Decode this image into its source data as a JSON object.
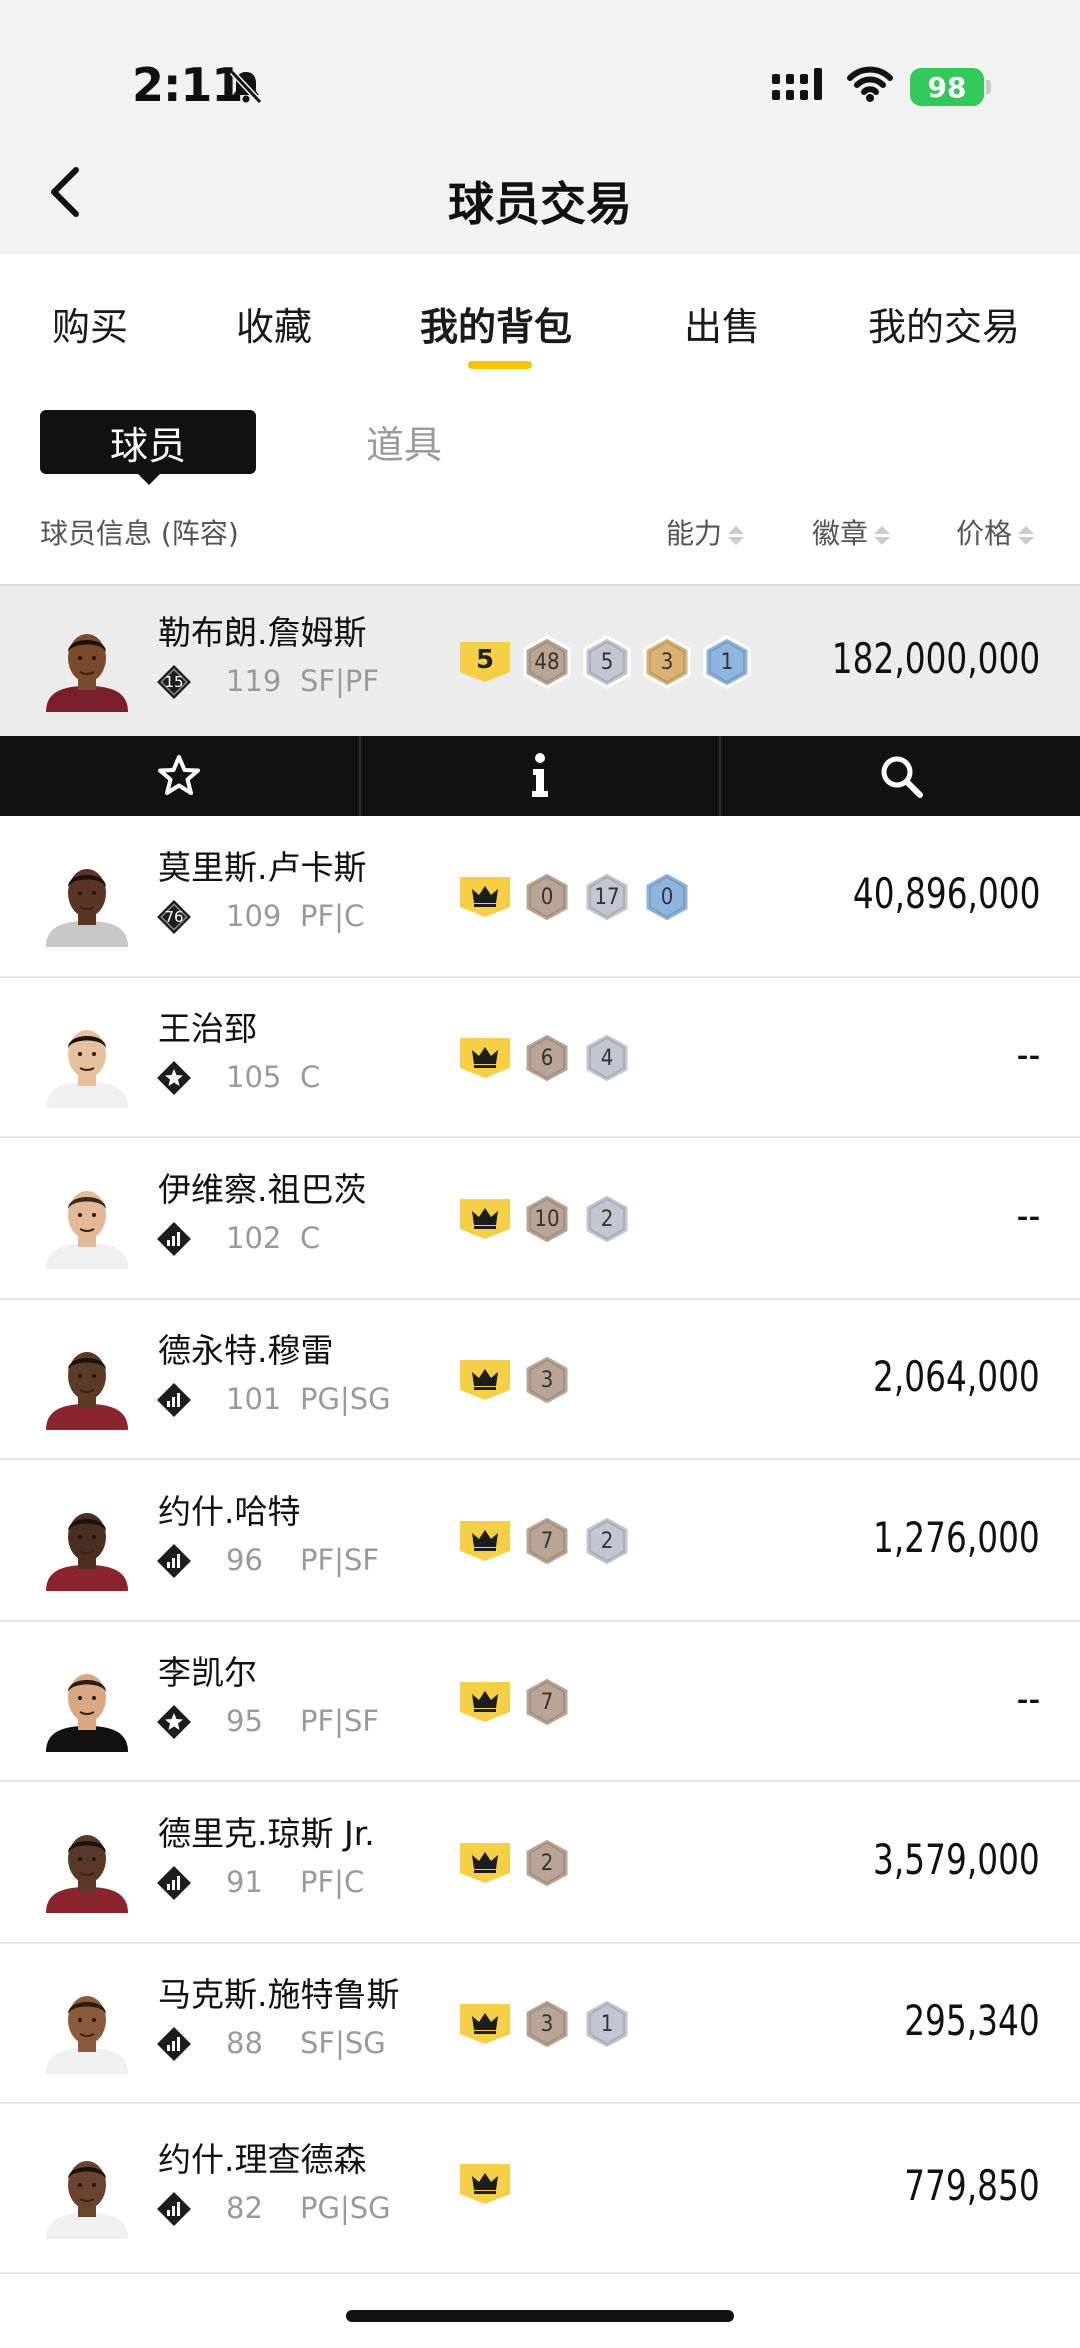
{
  "status_bar": {
    "time": "2:11",
    "battery": "98"
  },
  "header": {
    "title": "球员交易"
  },
  "tabs": [
    {
      "label": "购买"
    },
    {
      "label": "收藏"
    },
    {
      "label": "我的背包"
    },
    {
      "label": "出售"
    },
    {
      "label": "我的交易"
    }
  ],
  "segment": {
    "player": "球员",
    "items": "道具"
  },
  "list_header": {
    "info": "球员信息 (阵容)",
    "ability": "能力",
    "badge": "徽章",
    "price": "价格"
  },
  "rows": [
    {
      "name": "勒布朗.詹姆斯",
      "rank": "15",
      "rating": "119",
      "pos": "SF|PF",
      "level": "5",
      "badges": [
        "48",
        "5",
        "3",
        "1"
      ],
      "price": "182,000,000"
    },
    {
      "name": "莫里斯.卢卡斯",
      "rank": "76",
      "rating": "109",
      "pos": "PF|C",
      "badges": [
        "0",
        "17",
        "0"
      ],
      "price": "40,896,000"
    },
    {
      "name": "王治郅",
      "rating": "105",
      "pos": "C",
      "badges": [
        "6",
        "4"
      ],
      "price": "--"
    },
    {
      "name": "伊维察.祖巴茨",
      "rating": "102",
      "pos": "C",
      "badges": [
        "10",
        "2"
      ],
      "price": "--"
    },
    {
      "name": "德永特.穆雷",
      "rating": "101",
      "pos": "PG|SG",
      "badges": [
        "3"
      ],
      "price": "2,064,000"
    },
    {
      "name": "约什.哈特",
      "rating": "96",
      "pos": "PF|SF",
      "badges": [
        "7",
        "2"
      ],
      "price": "1,276,000"
    },
    {
      "name": "李凯尔",
      "rating": "95",
      "pos": "PF|SF",
      "badges": [
        "7"
      ],
      "price": "--"
    },
    {
      "name": "德里克.琼斯 Jr.",
      "rating": "91",
      "pos": "PF|C",
      "badges": [
        "2"
      ],
      "price": "3,579,000"
    },
    {
      "name": "马克斯.施特鲁斯",
      "rating": "88",
      "pos": "SF|SG",
      "badges": [
        "3",
        "1"
      ],
      "price": "295,340"
    },
    {
      "name": "约什.理查德森",
      "rating": "82",
      "pos": "PG|SG",
      "badges": [],
      "price": "779,850"
    }
  ],
  "colors": {
    "accent": "#f5c400",
    "bronze": "#b9a596",
    "silver": "#c2c6d2",
    "gold": "#d8b374",
    "blue": "#8fb4de"
  },
  "icons": {
    "favorite": "star-icon",
    "info": "info-icon",
    "search": "search-icon"
  }
}
